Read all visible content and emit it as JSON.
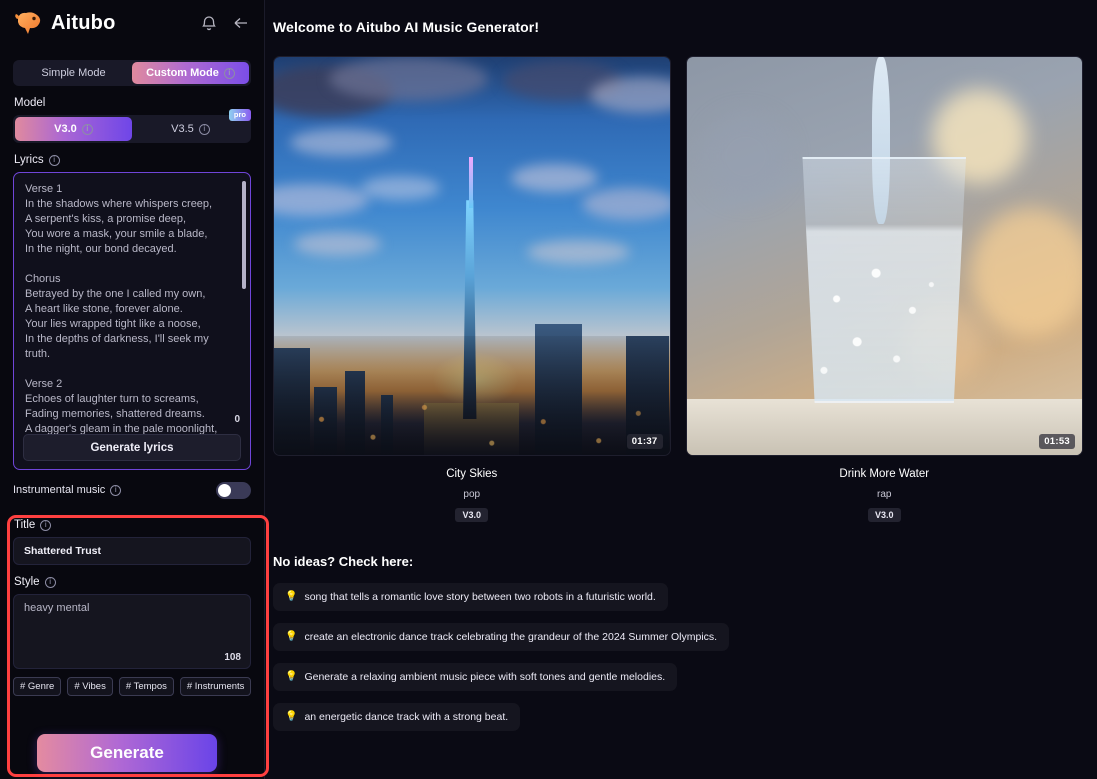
{
  "sidebar": {
    "brand": "Aitubo",
    "icons": {
      "bell": "bell-icon",
      "back": "back-arrow-icon"
    },
    "mode_toggle": {
      "simple": "Simple Mode",
      "custom": "Custom Mode",
      "active": "Custom Mode"
    },
    "model": {
      "label": "Model",
      "options": [
        {
          "label": "V3.0",
          "active": true,
          "badge": ""
        },
        {
          "label": "V3.5",
          "active": false,
          "badge": "pro"
        }
      ]
    },
    "lyrics": {
      "label": "Lyrics",
      "value": "Verse 1\nIn the shadows where whispers creep,\nA serpent's kiss, a promise deep,\nYou wore a mask, your smile a blade,\nIn the night, our bond decayed.\n\nChorus\nBetrayed by the one I called my own,\nA heart like stone, forever alone.\nYour lies wrapped tight like a noose,\nIn the depths of darkness, I'll seek my truth.\n\nVerse 2\nEchoes of laughter turn to screams,\nFading memories, shattered dreams.\nA dagger's gleam in the pale moonlight,\nYou struck me down without a fight.",
      "char_count": "0",
      "generate_button": "Generate lyrics"
    },
    "instrumental": {
      "label": "Instrumental music",
      "enabled": false
    },
    "title": {
      "label": "Title",
      "value": "Shattered Trust"
    },
    "style": {
      "label": "Style",
      "value": "heavy mental",
      "char_count": "108"
    },
    "tags": [
      "# Genre",
      "# Vibes",
      "# Tempos",
      "# Instruments"
    ],
    "generate_button": "Generate"
  },
  "main": {
    "welcome": "Welcome to Aitubo AI Music Generator!",
    "cards": [
      {
        "title": "City Skies",
        "genre": "pop",
        "version": "V3.0",
        "duration": "01:37",
        "scene": "city-sunset"
      },
      {
        "title": "Drink More Water",
        "genre": "rap",
        "version": "V3.0",
        "duration": "01:53",
        "scene": "water-glass"
      }
    ],
    "ideas_heading": "No ideas? Check here:",
    "ideas": [
      "song that tells a romantic love story between two robots in a futuristic world.",
      "create an electronic dance track celebrating the grandeur of the 2024 Summer Olympics.",
      "Generate a relaxing ambient music piece with soft tones and gentle melodies.",
      "an energetic dance track with a strong beat."
    ]
  },
  "colors": {
    "background": "#0a0a14",
    "accent_gradient_start": "#e48ba0",
    "accent_gradient_end": "#6a44e8",
    "highlight_outline": "#ff4040",
    "lyrics_border": "#6f45d8"
  }
}
